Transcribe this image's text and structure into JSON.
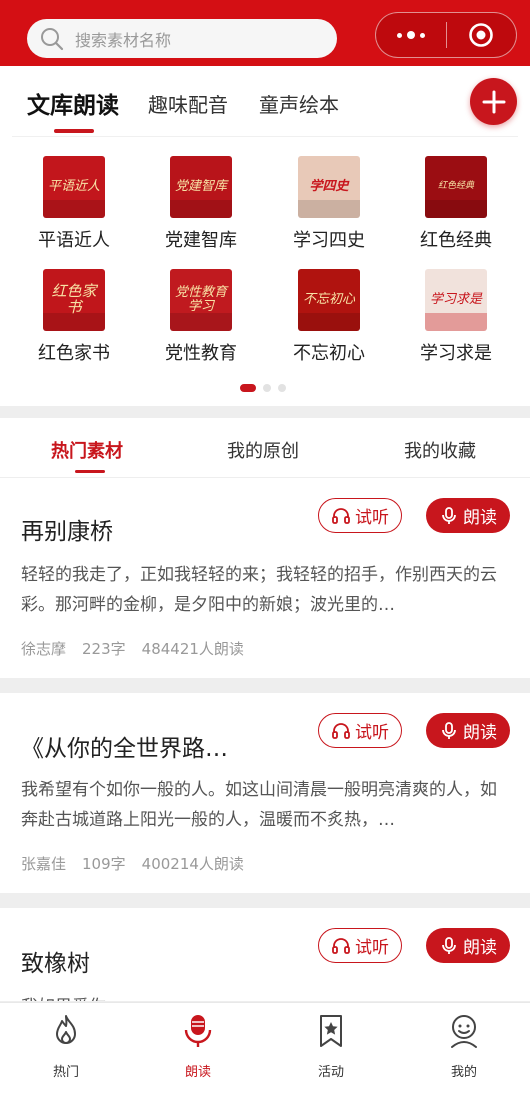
{
  "search": {
    "placeholder": "搜索素材名称"
  },
  "colors": {
    "brand": "#d40f14",
    "accent": "#c8161d",
    "muted": "#999999"
  },
  "top_tabs": [
    {
      "label": "文库朗读",
      "active": true
    },
    {
      "label": "趣味配音",
      "active": false
    },
    {
      "label": "童声绘本",
      "active": false
    }
  ],
  "categories": [
    {
      "label": "平语近人",
      "tile_text": "平语近人",
      "tile_color": "#c2161c"
    },
    {
      "label": "党建智库",
      "tile_text": "党建智库",
      "tile_color": "#b8141a"
    },
    {
      "label": "学习四史",
      "tile_text": "学四史",
      "tile_color": "#e8c9b8"
    },
    {
      "label": "红色经典",
      "tile_text": "红色经典",
      "tile_color": "#9b0d12"
    },
    {
      "label": "红色家书",
      "tile_text": "红色家书",
      "tile_color": "#c0161b"
    },
    {
      "label": "党性教育",
      "tile_text": "党性教育学习",
      "tile_color": "#c01a1f"
    },
    {
      "label": "不忘初心",
      "tile_text": "不忘初心",
      "tile_color": "#b0130f"
    },
    {
      "label": "学习求是",
      "tile_text": "学习求是",
      "tile_color": "#f1e2dc"
    }
  ],
  "pager": {
    "pages": 3,
    "current": 1
  },
  "sub_tabs": [
    {
      "label": "热门素材",
      "active": true
    },
    {
      "label": "我的原创",
      "active": false
    },
    {
      "label": "我的收藏",
      "active": false
    }
  ],
  "listen_label": "试听",
  "read_label": "朗读",
  "materials": [
    {
      "title": "再别康桥",
      "excerpt": "轻轻的我走了，正如我轻轻的来；我轻轻的招手，作别西天的云彩。那河畔的金柳，是夕阳中的新娘；波光里的…",
      "author": "徐志摩",
      "words": "223字",
      "reads": "484421人朗读"
    },
    {
      "title": "《从你的全世界路…",
      "excerpt": "我希望有个如你一般的人。如这山间清晨一般明亮清爽的人，如奔赴古城道路上阳光一般的人，温暖而不炙热，…",
      "author": "张嘉佳",
      "words": "109字",
      "reads": "400214人朗读"
    },
    {
      "title": "致橡树",
      "excerpt": "我如果爱你",
      "author": "",
      "words": "",
      "reads": ""
    }
  ],
  "bottom_nav": [
    {
      "label": "热门",
      "icon": "flame-icon",
      "active": false
    },
    {
      "label": "朗读",
      "icon": "microphone-icon",
      "active": true
    },
    {
      "label": "活动",
      "icon": "bookmark-star-icon",
      "active": false
    },
    {
      "label": "我的",
      "icon": "user-icon",
      "active": false
    }
  ]
}
